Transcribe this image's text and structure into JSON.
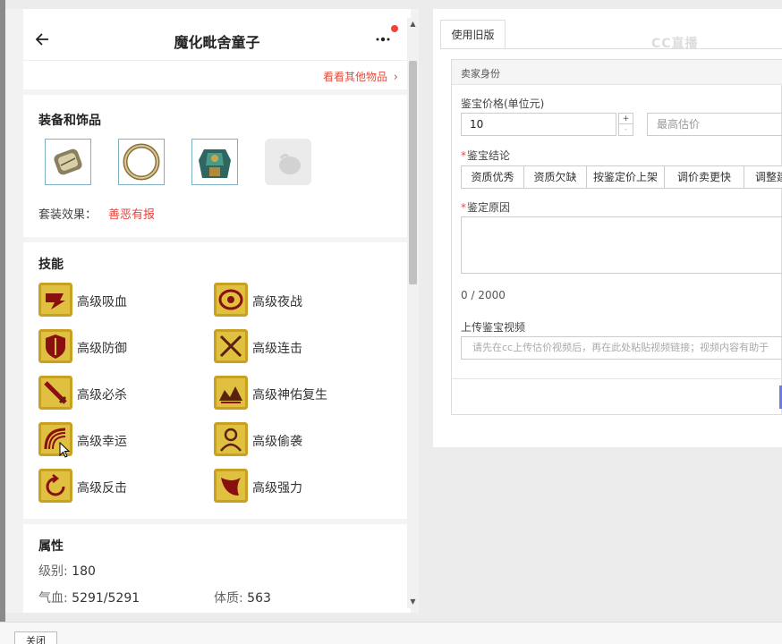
{
  "detail": {
    "title": "魔化毗舍童子",
    "other_items_link": "看看其他物品",
    "equipment_title": "装备和饰品",
    "equipment": [
      {
        "icon": "bracer-icon"
      },
      {
        "icon": "ring-icon"
      },
      {
        "icon": "armor-icon"
      },
      {
        "icon": "empty-slot-icon"
      }
    ],
    "set_effect_label": "套装效果：",
    "set_effect_value": "善恶有报",
    "skills_title": "技能",
    "skills": [
      {
        "label": "高级吸血",
        "icon": "blood-suck-icon"
      },
      {
        "label": "高级夜战",
        "icon": "night-battle-icon"
      },
      {
        "label": "高级防御",
        "icon": "defense-icon"
      },
      {
        "label": "高级连击",
        "icon": "combo-icon"
      },
      {
        "label": "高级必杀",
        "icon": "critical-icon"
      },
      {
        "label": "高级神佑复生",
        "icon": "divine-revive-icon"
      },
      {
        "label": "高级幸运",
        "icon": "luck-icon"
      },
      {
        "label": "高级偷袭",
        "icon": "sneak-attack-icon"
      },
      {
        "label": "高级反击",
        "icon": "counter-icon"
      },
      {
        "label": "高级强力",
        "icon": "power-icon"
      }
    ],
    "attributes_title": "属性",
    "level_label": "级别:",
    "level_value": "180",
    "hp_label": "气血:",
    "hp_value": "5291/5291",
    "constitution_label": "体质:",
    "constitution_value": "563"
  },
  "appraisal": {
    "tab_label": "使用旧版",
    "watermark": "CC直播",
    "seller_label": "卖家身份",
    "price_label": "鉴宝价格(单位元)",
    "price_value": "10",
    "max_price_placeholder": "最高估价",
    "conclusion_label": "鉴宝结论",
    "conclusions": [
      "资质优秀",
      "资质欠缺",
      "按鉴定价上架",
      "调价卖更快",
      "调整建"
    ],
    "reason_label": "鉴定原因",
    "char_count": "0 / 2000",
    "video_label": "上传鉴宝视频",
    "video_placeholder": "请先在cc上传估价视频后，再在此处粘贴视频链接；视频内容有助于"
  },
  "footer": {
    "close_label": "关闭"
  },
  "colors": {
    "accent_red": "#e8423a",
    "submit_blue": "#6a7ce0",
    "skill_gold": "#c9a020"
  }
}
